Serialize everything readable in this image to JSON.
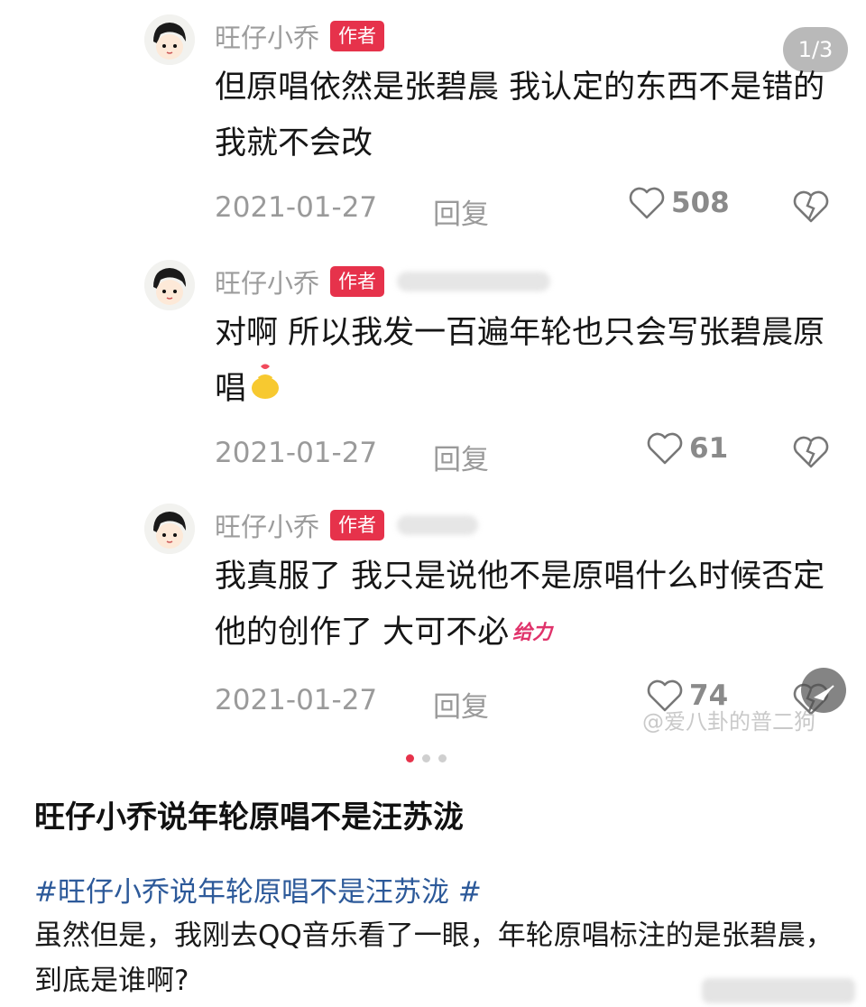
{
  "page_indicator": "1/3",
  "comments": [
    {
      "username": "旺仔小乔",
      "badge": "作者",
      "text": "但原唱依然是张碧晨 我认定的东西不是错的我就不会改",
      "date": "2021-01-27",
      "reply": "回复",
      "likes": "508"
    },
    {
      "username": "旺仔小乔",
      "badge": "作者",
      "text": "对啊 所以我发一百遍年轮也只会写张碧晨原唱",
      "date": "2021-01-27",
      "reply": "回复",
      "likes": "61"
    },
    {
      "username": "旺仔小乔",
      "badge": "作者",
      "text": "我真服了 我只是说他不是原唱什么时候否定他的创作了 大可不必",
      "sticker": "给力",
      "date": "2021-01-27",
      "reply": "回复",
      "likes": "74"
    }
  ],
  "watermark": "@爱八卦的普二狗",
  "carousel": {
    "total": 3,
    "active": 1
  },
  "post": {
    "title": "旺仔小乔说年轮原唱不是汪苏泷",
    "hashtag": "#旺仔小乔说年轮原唱不是汪苏泷 #",
    "body": "虽然但是，我刚去QQ音乐看了一眼，年轮原唱标注的是张碧晨，到底是谁啊?"
  },
  "colors": {
    "badge": "#e6324b",
    "hashtag": "#2d5a9a",
    "dot_active": "#e6324b"
  },
  "icons": [
    "heart-outline-icon",
    "broken-heart-icon",
    "share-icon",
    "sticker-icon"
  ]
}
